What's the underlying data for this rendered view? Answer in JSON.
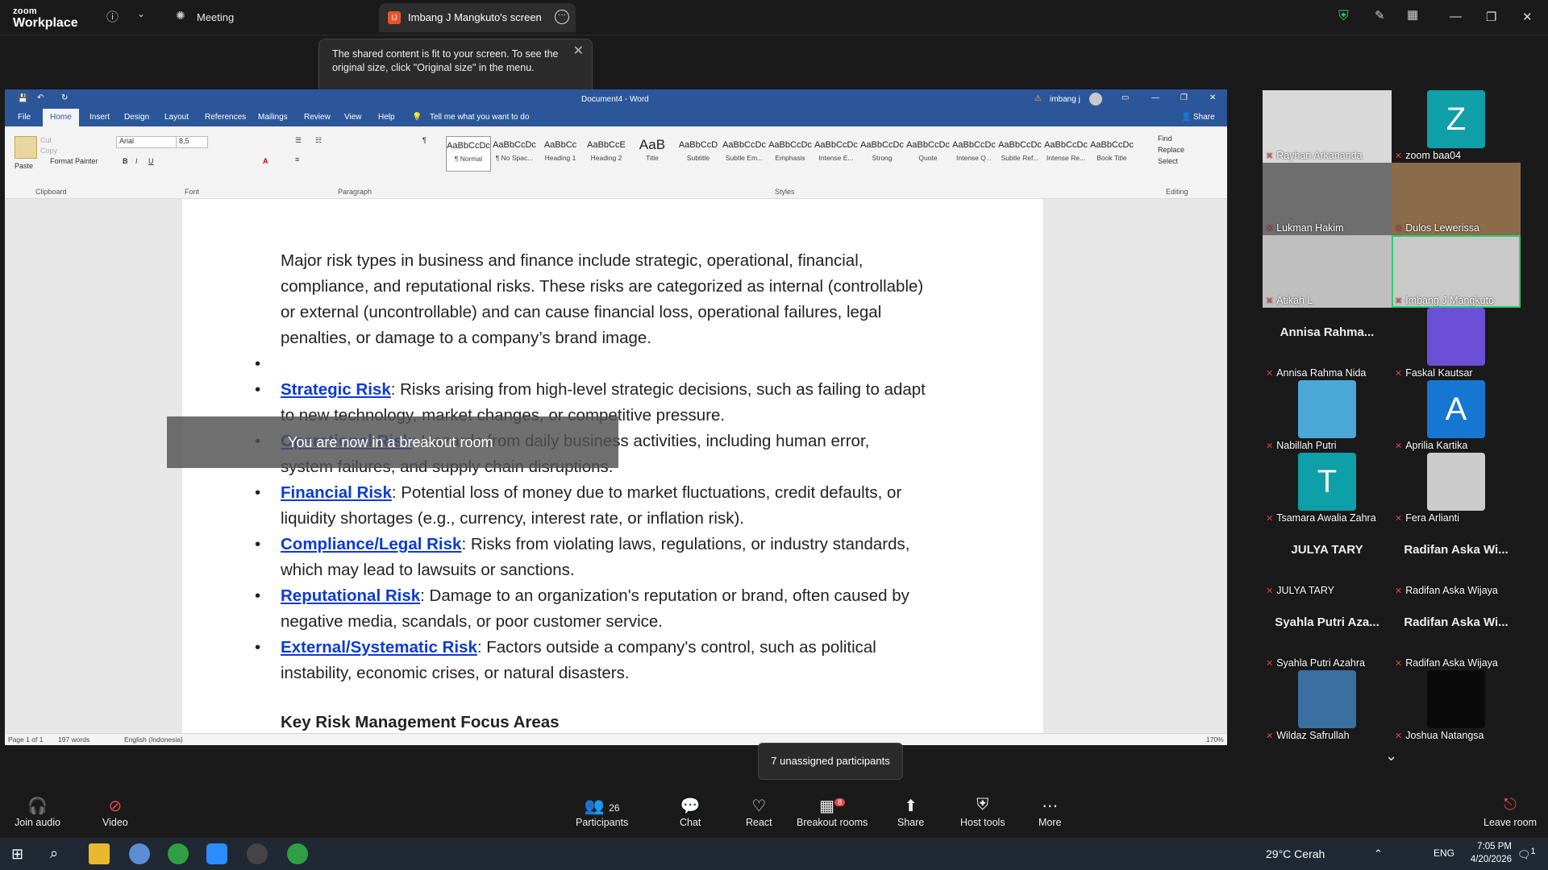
{
  "app": {
    "logo_top": "zoom",
    "logo_bottom": "Workplace",
    "meeting_label": "Meeting",
    "screen_tab_initial": "IJ",
    "screen_tab_label": "Imbang J Mangkuto's screen",
    "tooltip_text": "The shared content is fit to your screen. To see the original size, click \"Original size\" in the menu.",
    "breakout_banner": "You are now in a breakout room",
    "unassigned_tooltip": "7 unassigned participants"
  },
  "word": {
    "title": "Document4 - Word",
    "user": "imbang j",
    "tabs": [
      "File",
      "Home",
      "Insert",
      "Design",
      "Layout",
      "References",
      "Mailings",
      "Review",
      "View",
      "Help"
    ],
    "tell_me": "Tell me what you want to do",
    "share": "Share",
    "clipboard": {
      "paste": "Paste",
      "cut": "Cut",
      "copy": "Copy",
      "format_painter": "Format Painter",
      "group": "Clipboard"
    },
    "font": {
      "name": "Arial",
      "size": "8,5",
      "group": "Font"
    },
    "paragraph_group": "Paragraph",
    "styles_group": "Styles",
    "editing": {
      "find": "Find",
      "replace": "Replace",
      "select": "Select",
      "group": "Editing"
    },
    "styles": [
      {
        "preview": "AaBbCcDc",
        "name": "¶ Normal"
      },
      {
        "preview": "AaBbCcDc",
        "name": "¶ No Spac..."
      },
      {
        "preview": "AaBbCc",
        "name": "Heading 1"
      },
      {
        "preview": "AaBbCcE",
        "name": "Heading 2"
      },
      {
        "preview": "AaB",
        "name": "Title"
      },
      {
        "preview": "AaBbCcD",
        "name": "Subtitle"
      },
      {
        "preview": "AaBbCcDc",
        "name": "Subtle Em..."
      },
      {
        "preview": "AaBbCcDc",
        "name": "Emphasis"
      },
      {
        "preview": "AaBbCcDc",
        "name": "Intense E..."
      },
      {
        "preview": "AaBbCcDc",
        "name": "Strong"
      },
      {
        "preview": "AaBbCcDc",
        "name": "Quote"
      },
      {
        "preview": "AaBbCcDc",
        "name": "Intense Q..."
      },
      {
        "preview": "AaBbCcDc",
        "name": "Subtle Ref..."
      },
      {
        "preview": "AaBbCcDc",
        "name": "Intense Re..."
      },
      {
        "preview": "AaBbCcDc",
        "name": "Book Title"
      }
    ],
    "status": {
      "page": "Page 1 of 1",
      "words": "197 words",
      "lang": "English (Indonesia)",
      "zoom": "170%"
    },
    "doc": {
      "intro": "Major risk types in business and finance include strategic, operational, financial, compliance, and reputational risks. These risks are categorized as internal (controllable) or external (uncontrollable) and can cause financial loss, operational failures, legal penalties, or damage to a company’s brand image.",
      "bullets": [
        {
          "term": "Strategic Risk",
          "text": ": Risks arising from high-level strategic decisions, such as failing to adapt to new technology, market changes, or competitive pressure."
        },
        {
          "term": "Operational Risk",
          "text": ": Hazards from daily business activities, including human error, system failures, and supply chain disruptions."
        },
        {
          "term": "Financial Risk",
          "text": ": Potential loss of money due to market fluctuations, credit defaults, or liquidity shortages (e.g., currency, interest rate, or inflation risk)."
        },
        {
          "term": "Compliance/Legal Risk",
          "text": ": Risks from violating laws, regulations, or industry standards, which may lead to lawsuits or sanctions."
        },
        {
          "term": "Reputational Risk",
          "text": ": Damage to an organization's reputation or brand, often caused by negative media, scandals, or poor customer service."
        },
        {
          "term": "External/Systematic Risk",
          "text": ": Factors outside a company's control, such as political instability, economic crises, or natural disasters."
        }
      ],
      "heading": "Key Risk Management Focus Areas"
    }
  },
  "participants": [
    {
      "name": "Rayhan Arkananda",
      "kind": "video",
      "color": "#d9d9d9"
    },
    {
      "name": "zoom baa04",
      "kind": "letter",
      "letter": "Z",
      "color": "#0e9fa8"
    },
    {
      "name": "Lukman Hakim",
      "kind": "video",
      "color": "#6e6e6e"
    },
    {
      "name": "Dulos Lewerissa",
      "kind": "video",
      "color": "#8a6b4a"
    },
    {
      "name": "Atikah L",
      "kind": "video",
      "color": "#bfbfbf"
    },
    {
      "name": "Imbang J Mangkuto",
      "kind": "video",
      "color": "#c9c9c9"
    },
    {
      "name": "Annisa Rahma Nida",
      "kind": "name",
      "big": "Annisa Rahma..."
    },
    {
      "name": "Faskal Kautsar",
      "kind": "letter",
      "letter": "",
      "color": "#6b4fd6"
    },
    {
      "name": "Nabillah Putri",
      "kind": "letter",
      "letter": "",
      "color": "#4aa7d8"
    },
    {
      "name": "Aprilia Kartika",
      "kind": "letter",
      "letter": "A",
      "color": "#1677d2"
    },
    {
      "name": "Tsamara Awalia Zahra",
      "kind": "letter",
      "letter": "T",
      "color": "#0e9fa8"
    },
    {
      "name": "Fera Arlianti",
      "kind": "letter",
      "letter": "",
      "color": "#ccc"
    },
    {
      "name": "JULYA TARY",
      "kind": "name",
      "big": "JULYA TARY"
    },
    {
      "name": "Radifan Aska Wijaya",
      "kind": "name",
      "big": "Radifan Aska Wi..."
    },
    {
      "name": "Syahla Putri Azahra",
      "kind": "name",
      "big": "Syahla Putri Aza..."
    },
    {
      "name": "Radifan Aska Wijaya",
      "kind": "name",
      "big": "Radifan Aska Wi..."
    },
    {
      "name": "Wildaz Safrullah",
      "kind": "letter",
      "letter": "",
      "color": "#3b6fa0"
    },
    {
      "name": "Joshua Natangsa",
      "kind": "letter",
      "letter": "",
      "color": "#0a0a0a"
    }
  ],
  "toolbar": {
    "join_audio": "Join audio",
    "video": "Video",
    "participants": "Participants",
    "participants_count": "26",
    "chat": "Chat",
    "react": "React",
    "breakout": "Breakout rooms",
    "breakout_badge": "8",
    "share": "Share",
    "host_tools": "Host tools",
    "more": "More",
    "leave": "Leave room"
  },
  "taskbar": {
    "weather": "29°C Cerah",
    "lang": "ENG",
    "time": "7:05 PM",
    "date": "4/20/2026",
    "notif": "1"
  }
}
